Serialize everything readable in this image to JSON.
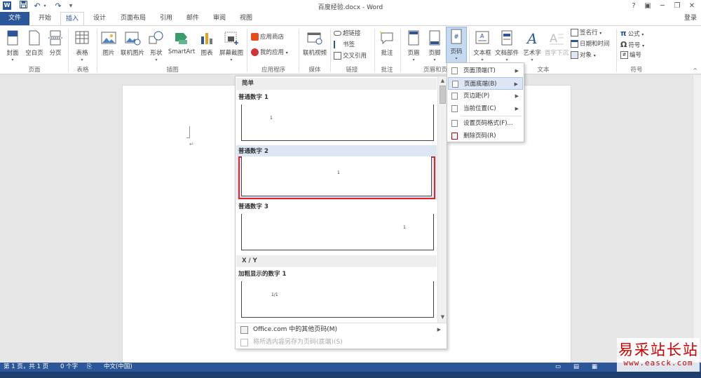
{
  "app": {
    "title": "百度经验.docx - Word",
    "quick_access": {
      "undo": "↶",
      "redo": "↷",
      "customize": "▼"
    },
    "window_controls": {
      "help": "?",
      "restore_ribbon": "▣",
      "minimize": "─",
      "maximize": "❐",
      "close": "✕"
    },
    "login": "登录"
  },
  "tabs": [
    "文件",
    "开始",
    "插入",
    "设计",
    "页面布局",
    "引用",
    "邮件",
    "审阅",
    "视图"
  ],
  "ribbon": {
    "groups": {
      "pages": {
        "label": "页面",
        "buttons": [
          "封面",
          "空白页",
          "分页"
        ]
      },
      "tables": {
        "label": "表格",
        "buttons": [
          "表格"
        ]
      },
      "illustrations": {
        "label": "插图",
        "buttons": [
          "图片",
          "联机图片",
          "形状",
          "SmartArt",
          "图表",
          "屏幕截图"
        ]
      },
      "apps": {
        "label": "应用程序",
        "buttons": [
          "应用商店",
          "我的应用"
        ]
      },
      "media": {
        "label": "媒体",
        "buttons": [
          "联机视频"
        ]
      },
      "links": {
        "label": "链接",
        "buttons": [
          "超链接",
          "书签",
          "交叉引用"
        ]
      },
      "comments": {
        "label": "批注",
        "buttons": [
          "批注"
        ]
      },
      "header_footer": {
        "label": "页眉和页",
        "buttons": [
          "页眉",
          "页脚",
          "页码"
        ]
      },
      "text": {
        "label": "文本",
        "buttons": [
          "文本框",
          "文档部件",
          "艺术字",
          "首字下沉"
        ],
        "side": [
          "签名行",
          "日期和时间",
          "对象"
        ]
      },
      "symbols": {
        "label": "符号",
        "buttons": [
          "公式",
          "符号",
          "编号"
        ]
      }
    },
    "collapse_icon": "^"
  },
  "document": {
    "paragraph_mark": "↵"
  },
  "gallery": {
    "section_simple": "简单",
    "section_xy": "X / Y",
    "items": [
      {
        "label": "普通数字 1",
        "num": "1"
      },
      {
        "label": "普通数字 2",
        "num": "1"
      },
      {
        "label": "普通数字 3",
        "num": "1"
      },
      {
        "label": "加粗显示的数字 1",
        "num": "1/1"
      }
    ],
    "footer": [
      {
        "label": "Office.com 中的其他页码(M)"
      },
      {
        "label": "将所选内容另存为页码(底端)(S)"
      }
    ],
    "scroll_up": "▲",
    "scroll_down": "▼"
  },
  "submenu": {
    "items": [
      "页面顶端(T)",
      "页面底端(B)",
      "页边距(P)",
      "当前位置(C)",
      "设置页码格式(F)...",
      "删除页码(R)"
    ]
  },
  "status": {
    "page": "第 1 页，共 1 页",
    "words": "0 个字",
    "language": "中文(中国)"
  },
  "watermark": {
    "main": "易采站长站",
    "url": "www.easck.com"
  },
  "colors": {
    "accent": "#2b579a",
    "highlight": "#dce6f4",
    "selection_border": "#e0242a",
    "watermark": "#cc0000"
  }
}
